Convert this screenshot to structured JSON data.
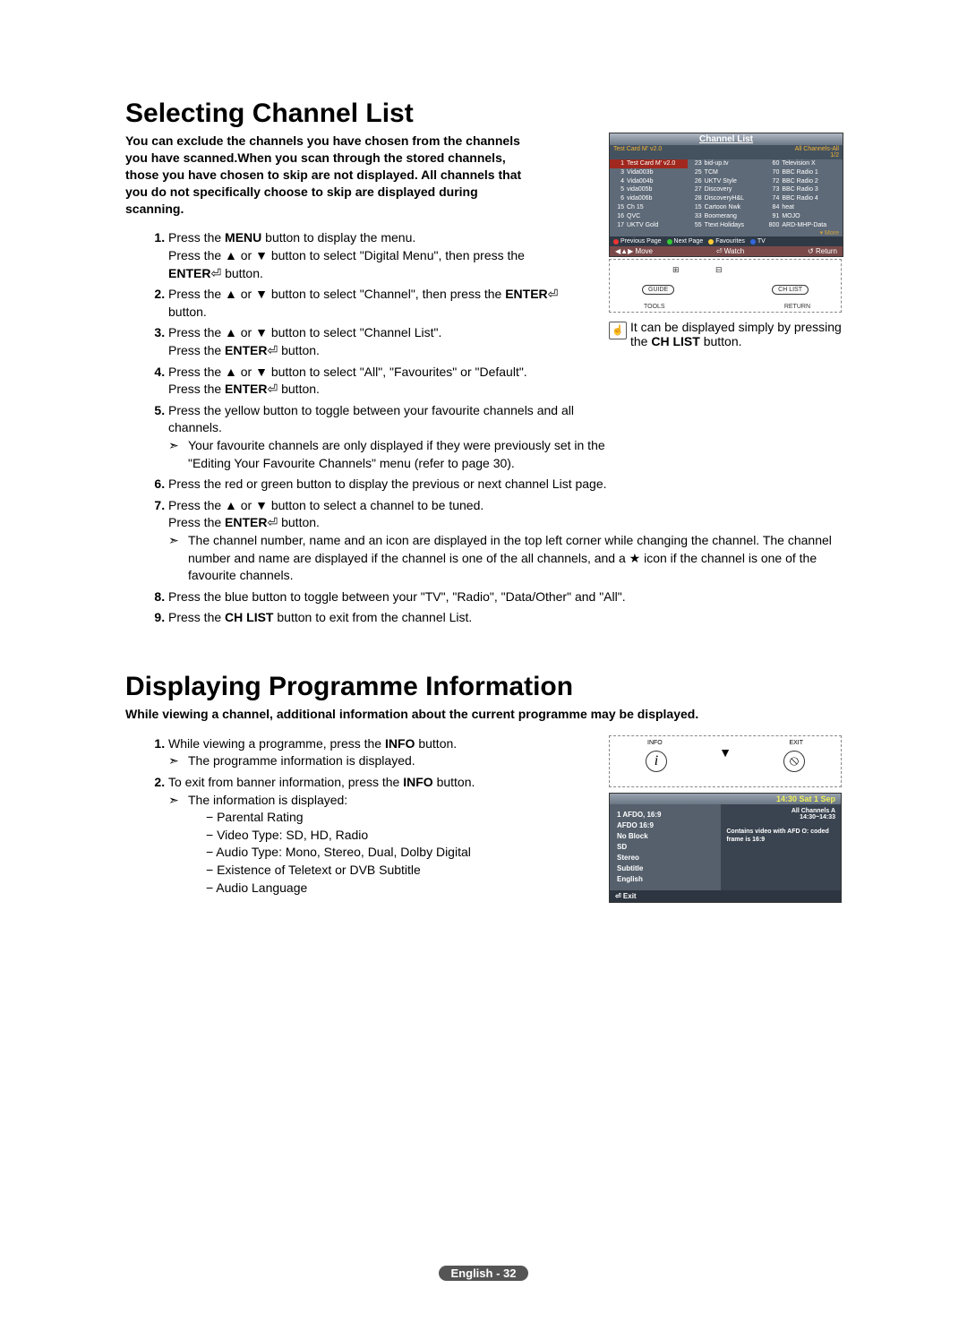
{
  "section1": {
    "title": "Selecting Channel List",
    "intro": "You can exclude the channels you have chosen from the channels you have scanned.When you scan through the stored channels, those you have chosen to skip are not displayed. All channels that you do not specifically choose to skip are displayed during scanning.",
    "steps": {
      "s1a": "Press the ",
      "s1b": "MENU",
      "s1c": " button to display the menu.",
      "s1d": "Press the ▲ or ▼ button to select \"Digital Menu\", then press the ",
      "s1e": "ENTER",
      "s1f": " button.",
      "s2a": "Press the ▲ or ▼ button to select \"Channel\", then press the ",
      "s2b": "ENTER",
      "s2c": " button.",
      "s3a": "Press the ▲ or ▼ button to select \"Channel List\".",
      "s3b": "Press the ",
      "s3c": "ENTER",
      "s3d": " button.",
      "s4a": "Press the ▲ or ▼ button to select \"All\", \"Favourites\" or \"Default\".",
      "s4b": "Press the ",
      "s4c": "ENTER",
      "s4d": " button.",
      "s5a": "Press the yellow button to toggle between your favourite channels and all channels.",
      "s5sub": "Your favourite channels are only displayed if they were previously set in the \"Editing Your Favourite Channels\" menu (refer to page 30).",
      "s6": "Press the red or green button to display the previous or next channel List page.",
      "s7a": "Press the ▲ or ▼ button to select a channel to be tuned.",
      "s7b": "Press the ",
      "s7c": "ENTER",
      "s7d": " button.",
      "s7sub": "The channel number, name and an icon are displayed in the top left corner while changing the channel. The channel number and name are displayed if the channel is one of the all channels, and a ★ icon if the channel is one of the favourite channels.",
      "s8": "Press the blue button to toggle between your \"TV\", \"Radio\", \"Data/Other\" and \"All\".",
      "s9a": "Press the ",
      "s9b": "CH LIST",
      "s9c": " button to exit from the channel List."
    },
    "note": {
      "a": "It can be displayed simply by pressing the ",
      "b": "CH LIST",
      "c": " button."
    }
  },
  "osd": {
    "title": "Channel List",
    "header_left": "Test Card M' v2.0",
    "header_right_a": "All Channels-All",
    "header_right_b": "1/2",
    "col1": [
      {
        "n": "1",
        "t": "Test Card M' v2.0"
      },
      {
        "n": "3",
        "t": "Vida003b"
      },
      {
        "n": "4",
        "t": "Vida004b"
      },
      {
        "n": "5",
        "t": "vida005b"
      },
      {
        "n": "6",
        "t": "vida006b"
      },
      {
        "n": "15",
        "t": "Ch 15"
      },
      {
        "n": "16",
        "t": "QVC"
      },
      {
        "n": "17",
        "t": "UKTV Gold"
      }
    ],
    "col2": [
      {
        "n": "23",
        "t": "bid-up.tv"
      },
      {
        "n": "25",
        "t": "TCM"
      },
      {
        "n": "26",
        "t": "UKTV Style"
      },
      {
        "n": "27",
        "t": "Discovery"
      },
      {
        "n": "28",
        "t": "DiscoveryH&L"
      },
      {
        "n": "15",
        "t": "Cartoon Nwk"
      },
      {
        "n": "33",
        "t": "Boomerang"
      },
      {
        "n": "55",
        "t": "Ttext Holidays"
      }
    ],
    "col3": [
      {
        "n": "60",
        "t": "Television X"
      },
      {
        "n": "70",
        "t": "BBC Radio 1"
      },
      {
        "n": "72",
        "t": "BBC Radio 2"
      },
      {
        "n": "73",
        "t": "BBC Radio 3"
      },
      {
        "n": "74",
        "t": "BBC Radio 4"
      },
      {
        "n": "84",
        "t": "heat"
      },
      {
        "n": "91",
        "t": "MOJO"
      },
      {
        "n": "800",
        "t": "ARD-MHP-Data"
      }
    ],
    "more": "▾ More",
    "legend": {
      "prev": "Previous Page",
      "next": "Next Page",
      "fav": "Favourites",
      "tv": "TV"
    },
    "bottom": {
      "move": "◀▲▶ Move",
      "watch": "⏎ Watch",
      "ret": "↺ Return"
    },
    "remote": {
      "guide": "GUIDE",
      "chlist": "CH LIST",
      "tools": "TOOLS",
      "return": "RETURN"
    }
  },
  "section2": {
    "title": "Displaying Programme Information",
    "intro": "While viewing a channel, additional information about the current programme may be displayed.",
    "steps": {
      "s1a": "While viewing a programme, press the ",
      "s1b": "INFO",
      "s1c": " button.",
      "s1sub": "The programme information is displayed.",
      "s2a": "To exit from banner information, press the ",
      "s2b": "INFO",
      "s2c": " button.",
      "s2sub": "The information is displayed:",
      "d1": "Parental Rating",
      "d2": "Video Type: SD, HD, Radio",
      "d3": "Audio Type: Mono, Stereo, Dual, Dolby Digital",
      "d4": "Existence of Teletext or DVB Subtitle",
      "d5": "Audio Language"
    }
  },
  "info_osd": {
    "remote": {
      "info": "INFO",
      "exit": "EXIT"
    },
    "time": "14:30 Sat 1 Sep",
    "left": [
      "1 AFDO, 16:9",
      "AFDO 16:9",
      "No Block",
      "SD",
      "Stereo",
      "Subtitle",
      "English"
    ],
    "right": {
      "l1": "All Channels  A",
      "l2": "14:30~14:33",
      "desc": "Contains video with AFD O: coded frame is 16:9"
    },
    "exit": "⏎ Exit"
  },
  "footer": {
    "lang": "English - 32"
  }
}
